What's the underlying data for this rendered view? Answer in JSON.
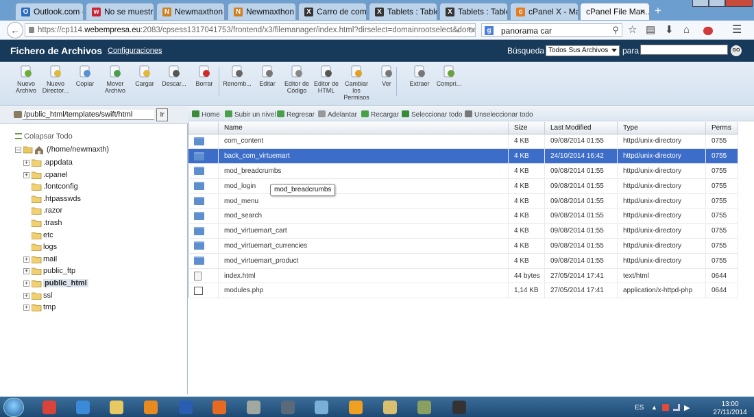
{
  "browser": {
    "tabs": [
      {
        "label": "Outlook.com -...",
        "icon_color": "#2a6bc0",
        "icon_char": "O"
      },
      {
        "label": "No se muestra ...",
        "icon_color": "#cc2233",
        "icon_char": "w"
      },
      {
        "label": "Newmaxthon ...",
        "icon_color": "#d08020",
        "icon_char": "N"
      },
      {
        "label": "Newmaxthon ...",
        "icon_color": "#d08020",
        "icon_char": "N"
      },
      {
        "label": "Carro de comp...",
        "icon_color": "#333333",
        "icon_char": "X"
      },
      {
        "label": "Tablets : Table...",
        "icon_color": "#333333",
        "icon_char": "X"
      },
      {
        "label": "Tablets : Table...",
        "icon_color": "#333333",
        "icon_char": "X"
      },
      {
        "label": "cPanel X - Main",
        "icon_color": "#e57d24",
        "icon_char": "c"
      },
      {
        "label": "cPanel File Man...",
        "active": true,
        "close": "×"
      }
    ],
    "new_tab_symbol": "+",
    "url_prefix": "https://cp114.",
    "url_domain": "webempresa.eu",
    "url_rest": ":2083/cpsess1317041753/frontend/x3/filemanager/index.html?dirselect=domainrootselect&domainselect=newma",
    "search_engine_badge": "g",
    "search_query": "panorama car"
  },
  "header": {
    "title": "Fichero de Archivos",
    "settings_link": "Configuraciones",
    "search_label": "Búsqueda",
    "search_scope": "Todos Sus Archivos",
    "for_label": "para",
    "go_label": "GO"
  },
  "toolbar": {
    "buttons": [
      {
        "label": "Nuevo Archivo",
        "icon": "new-file-icon",
        "color": "#6fae3a"
      },
      {
        "label": "Nuevo Director...",
        "icon": "new-folder-icon",
        "color": "#e0b83a"
      },
      {
        "label": "Copiar",
        "icon": "copy-icon",
        "color": "#5a8fd0"
      },
      {
        "label": "Mover Archivo",
        "icon": "move-icon",
        "color": "#4aa04a"
      },
      {
        "label": "Cargar",
        "icon": "upload-icon",
        "color": "#e0b83a"
      },
      {
        "label": "Descar...",
        "icon": "download-icon",
        "color": "#555555"
      },
      {
        "label": "Borrar",
        "icon": "delete-icon",
        "color": "#d02a2a"
      },
      {
        "label": "Renomb...",
        "icon": "rename-icon",
        "color": "#666666"
      },
      {
        "label": "Editar",
        "icon": "edit-icon",
        "color": "#777777"
      },
      {
        "label": "Editor de Código",
        "icon": "code-editor-icon",
        "color": "#888888"
      },
      {
        "label": "Editor de HTML",
        "icon": "html-editor-icon",
        "color": "#555555"
      },
      {
        "label": "Cambiar los Permisos",
        "icon": "permissions-key-icon",
        "color": "#e0a020"
      },
      {
        "label": "Ver",
        "icon": "view-magnifier-icon",
        "color": "#777777"
      },
      {
        "label": "Extraer",
        "icon": "extract-icon",
        "color": "#777777"
      },
      {
        "label": "Compri...",
        "icon": "compress-icon",
        "color": "#6aa040"
      }
    ]
  },
  "tree": {
    "path_value": "/public_html/templates/swift/html",
    "go_label": "Ir",
    "collapse_label": "Colapsar Todo",
    "root_label": "(/home/newmaxth)",
    "items": [
      {
        "label": ".appdata",
        "expander": "+"
      },
      {
        "label": ".cpanel",
        "expander": "+"
      },
      {
        "label": ".fontconfig",
        "expander": ""
      },
      {
        "label": ".htpasswds",
        "expander": ""
      },
      {
        "label": ".razor",
        "expander": ""
      },
      {
        "label": ".trash",
        "expander": ""
      },
      {
        "label": "etc",
        "expander": ""
      },
      {
        "label": "logs",
        "expander": ""
      },
      {
        "label": "mail",
        "expander": "+"
      },
      {
        "label": "public_ftp",
        "expander": "+"
      },
      {
        "label": "public_html",
        "expander": "+",
        "selected": true
      },
      {
        "label": "ssl",
        "expander": "+"
      },
      {
        "label": "tmp",
        "expander": "+"
      }
    ]
  },
  "actions": [
    {
      "label": "Home",
      "icon": "home-icon",
      "color": "#3a8a3a"
    },
    {
      "label": "Subir un nivel",
      "icon": "up-level-icon",
      "color": "#4aa04a"
    },
    {
      "label": "Regresar",
      "icon": "back-arrow-icon",
      "color": "#4aa04a"
    },
    {
      "label": "Adelantar",
      "icon": "forward-arrow-icon",
      "color": "#999999"
    },
    {
      "label": "Recargar",
      "icon": "reload-icon",
      "color": "#4aa04a"
    },
    {
      "label": "Seleccionar todo",
      "icon": "select-all-icon",
      "color": "#3a8a3a"
    },
    {
      "label": "Unseleccionar todo",
      "icon": "unselect-all-icon",
      "color": "#777777"
    }
  ],
  "files": {
    "columns": [
      "Name",
      "Size",
      "Last Modified",
      "Type",
      "Perms"
    ],
    "rows": [
      {
        "name": "com_content",
        "size": "4 KB",
        "modified": "09/08/2014 01:55",
        "type": "httpd/unix-directory",
        "perms": "0755",
        "kind": "folder"
      },
      {
        "name": "back_com_virtuemart",
        "size": "4 KB",
        "modified": "24/10/2014 16:42",
        "type": "httpd/unix-directory",
        "perms": "0755",
        "kind": "folder",
        "selected": true
      },
      {
        "name": "mod_breadcrumbs",
        "size": "4 KB",
        "modified": "09/08/2014 01:55",
        "type": "httpd/unix-directory",
        "perms": "0755",
        "kind": "folder"
      },
      {
        "name": "mod_login",
        "size": "4 KB",
        "modified": "09/08/2014 01:55",
        "type": "httpd/unix-directory",
        "perms": "0755",
        "kind": "folder"
      },
      {
        "name": "mod_menu",
        "size": "4 KB",
        "modified": "09/08/2014 01:55",
        "type": "httpd/unix-directory",
        "perms": "0755",
        "kind": "folder"
      },
      {
        "name": "mod_search",
        "size": "4 KB",
        "modified": "09/08/2014 01:55",
        "type": "httpd/unix-directory",
        "perms": "0755",
        "kind": "folder"
      },
      {
        "name": "mod_virtuemart_cart",
        "size": "4 KB",
        "modified": "09/08/2014 01:55",
        "type": "httpd/unix-directory",
        "perms": "0755",
        "kind": "folder"
      },
      {
        "name": "mod_virtuemart_currencies",
        "size": "4 KB",
        "modified": "09/08/2014 01:55",
        "type": "httpd/unix-directory",
        "perms": "0755",
        "kind": "folder"
      },
      {
        "name": "mod_virtuemart_product",
        "size": "4 KB",
        "modified": "09/08/2014 01:55",
        "type": "httpd/unix-directory",
        "perms": "0755",
        "kind": "folder"
      },
      {
        "name": "index.html",
        "size": "44 bytes",
        "modified": "27/05/2014 17:41",
        "type": "text/html",
        "perms": "0644",
        "kind": "html"
      },
      {
        "name": "modules.php",
        "size": "1,14 KB",
        "modified": "27/05/2014 17:41",
        "type": "application/x-httpd-php",
        "perms": "0644",
        "kind": "php"
      }
    ]
  },
  "tooltip": "mod_breadcrumbs",
  "taskbar": {
    "apps": [
      {
        "name": "chrome",
        "color": "#d8443a"
      },
      {
        "name": "internet-explorer",
        "color": "#3a8ad8"
      },
      {
        "name": "file-explorer",
        "color": "#e8c860"
      },
      {
        "name": "media-player",
        "color": "#e88a20"
      },
      {
        "name": "word",
        "color": "#2a5cb0"
      },
      {
        "name": "firefox",
        "color": "#e86a20"
      },
      {
        "name": "recycle-bin",
        "color": "#a0a8a0"
      },
      {
        "name": "app-8",
        "color": "#5a6a7a"
      },
      {
        "name": "app-9",
        "color": "#7ab0d8"
      },
      {
        "name": "norton",
        "color": "#f0a020"
      },
      {
        "name": "app-11",
        "color": "#d8c070"
      },
      {
        "name": "app-12",
        "color": "#8aa060"
      },
      {
        "name": "studio",
        "color": "#333333"
      }
    ],
    "lang": "ES",
    "time": "13:00",
    "date": "27/11/2014"
  }
}
